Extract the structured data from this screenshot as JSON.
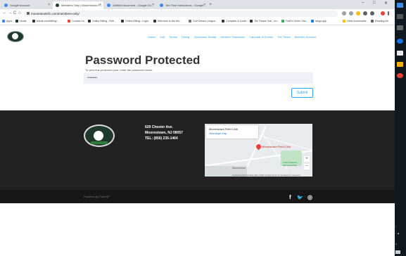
{
  "browser": {
    "tabs": [
      {
        "label": "Google Account",
        "color": "#4285f4"
      },
      {
        "label": "Members Only | Moorestown Fi...",
        "color": "#1f3a2b"
      },
      {
        "label": "Untitled document - Google Do...",
        "color": "#4285f4"
      },
      {
        "label": "Tee Time Instructions - Google ...",
        "color": "#4285f4"
      }
    ],
    "new_tab": "+",
    "window_controls": {
      "minimize": "–",
      "maximize": "□",
      "close": "✕"
    },
    "url": "moorestownfc.com/members-only/",
    "nav": {
      "back": "←",
      "forward": "→",
      "reload": "C",
      "home": "⌂"
    },
    "bookmarks": [
      "Apps",
      "Home",
      "mtsdb.com/billing/...",
      "Contact Us",
      "Online Billing - Sett...",
      "Online Billing - Login",
      "Welcome to the Mo...",
      "Golf Genius League...",
      "Complete & Conte...",
      "Tee Times! Hub - rm...",
      "FedEx Green Stro...",
      "range-app",
      "Other bookmarks",
      "Reading list"
    ]
  },
  "site": {
    "nav": [
      "Home",
      "Golf",
      "Tennis",
      "Dining",
      "Clubhouse Rental",
      "Member Resources",
      "Calendar of Events",
      "Tee Times",
      "Member Account"
    ]
  },
  "main": {
    "title": "Password Protected",
    "prompt": "To view this protected post, enter the password below:",
    "password_value": "••••••••",
    "submit_label": "Submit"
  },
  "footer": {
    "address_line1": "629 Chester Ave.",
    "address_line2": "Moorestown, NJ 08057",
    "phone": "TEL: (856) 235-1464",
    "map": {
      "place_name": "Moorestown Field Club",
      "view_larger": "View larger map",
      "pin_label": "Moorestown Field Club",
      "area_label": "Moorestown",
      "park_label": "Frank Fellowes Memorial Park",
      "zoom_in": "+",
      "zoom_out": "−",
      "attribution": "Keyboard shortcuts   Map data ©2021 Google   Terms of Use   Report a map error"
    },
    "powered_by": "Powered by Fore!SP",
    "social": {
      "facebook": "f",
      "twitter": "🐦",
      "instagram": "◎"
    }
  },
  "colors": {
    "accent": "#2ea3f2",
    "footer_bg": "#222222",
    "bottom_bar": "#171717",
    "logo_green": "#1f3a2b"
  }
}
